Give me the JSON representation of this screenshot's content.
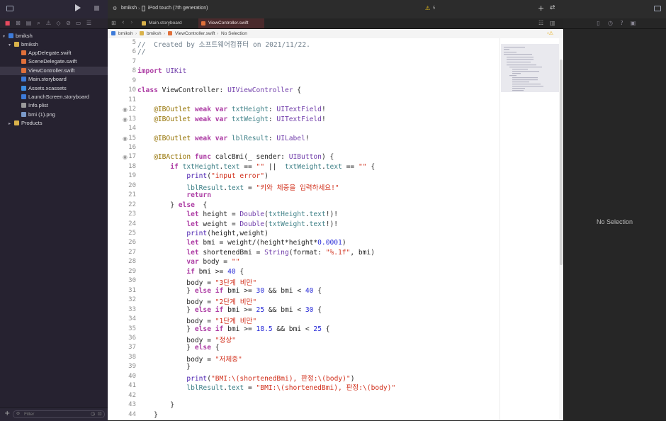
{
  "toolbar": {
    "scheme": "bmiksh",
    "device": "iPod touch (7th generation)",
    "warnings": "5"
  },
  "tabs": [
    {
      "label": "Main.storyboard"
    },
    {
      "label": "ViewController.swift"
    }
  ],
  "jumpbar": {
    "project": "bmiksh",
    "folder": "bmiksh",
    "file": "ViewController.swift",
    "selection": "No Selection"
  },
  "navigator": {
    "project": "bmiksh",
    "group": "bmiksh",
    "files": [
      {
        "name": "AppDelegate.swift",
        "color": "#e0703a"
      },
      {
        "name": "SceneDelegate.swift",
        "color": "#e0703a"
      },
      {
        "name": "ViewController.swift",
        "color": "#e0703a"
      },
      {
        "name": "Main.storyboard",
        "color": "#3d7bd9"
      },
      {
        "name": "Assets.xcassets",
        "color": "#3d8de0"
      },
      {
        "name": "LaunchScreen.storyboard",
        "color": "#3d7bd9"
      },
      {
        "name": "Info.plist",
        "color": "#9b9b9b"
      },
      {
        "name": "bmi (1).png",
        "color": "#7b9ac9"
      }
    ],
    "products": "Products",
    "filter_placeholder": "Filter"
  },
  "code_lines": [
    {
      "n": "5",
      "src": "//  Created by 소프트웨어컴퓨터 on 2021/11/22."
    },
    {
      "n": "6",
      "src": "//"
    },
    {
      "n": "7",
      "src": ""
    },
    {
      "n": "8",
      "src": "import UIKit"
    },
    {
      "n": "9",
      "src": ""
    },
    {
      "n": "10",
      "src": "class ViewController: UIViewController {"
    },
    {
      "n": "11",
      "src": ""
    },
    {
      "n": "12",
      "src": "    @IBOutlet weak var txtHeight: UITextField!"
    },
    {
      "n": "13",
      "src": "    @IBOutlet weak var txtWeight: UITextField!"
    },
    {
      "n": "14",
      "src": ""
    },
    {
      "n": "15",
      "src": "    @IBOutlet weak var lblResult: UILabel!"
    },
    {
      "n": "16",
      "src": ""
    },
    {
      "n": "17",
      "src": "    @IBAction func calcBmi(_ sender: UIButton) {"
    },
    {
      "n": "18",
      "src": "        if txtHeight.text == \"\" ||  txtWeight.text == \"\" {"
    },
    {
      "n": "19",
      "src": "            print(\"input error\")"
    },
    {
      "n": "20",
      "src": "            lblResult.text = \"키와 체중을 입력하세요!\""
    },
    {
      "n": "21",
      "src": "            return"
    },
    {
      "n": "22",
      "src": "        } else  {"
    },
    {
      "n": "23",
      "src": "            let height = Double(txtHeight.text!)!"
    },
    {
      "n": "24",
      "src": "            let weight = Double(txtWeight.text!)!"
    },
    {
      "n": "25",
      "src": "            print(height,weight)"
    },
    {
      "n": "26",
      "src": "            let bmi = weight/(height*height*0.0001)"
    },
    {
      "n": "27",
      "src": "            let shortenedBmi = String(format: \"%.1f\", bmi)"
    },
    {
      "n": "28",
      "src": "            var body = \"\""
    },
    {
      "n": "29",
      "src": "            if bmi >= 40 {"
    },
    {
      "n": "30",
      "src": "            body = \"3단계 비만\""
    },
    {
      "n": "31",
      "src": "            } else if bmi >= 30 && bmi < 40 {"
    },
    {
      "n": "32",
      "src": "            body = \"2단계 비만\""
    },
    {
      "n": "33",
      "src": "            } else if bmi >= 25 && bmi < 30 {"
    },
    {
      "n": "34",
      "src": "            body = \"1단계 비만\""
    },
    {
      "n": "35",
      "src": "            } else if bmi >= 18.5 && bmi < 25 {"
    },
    {
      "n": "36",
      "src": "            body = \"정상\""
    },
    {
      "n": "37",
      "src": "            } else {"
    },
    {
      "n": "38",
      "src": "            body = \"저체중\""
    },
    {
      "n": "39",
      "src": "            }"
    },
    {
      "n": "40",
      "src": "            print(\"BMI:\\(shortenedBmi), 판정:\\(body)\")"
    },
    {
      "n": "41",
      "src": "            lblResult.text = \"BMI:\\(shortenedBmi), 판정:\\(body)\""
    },
    {
      "n": "42",
      "src": ""
    },
    {
      "n": "43",
      "src": "        }"
    },
    {
      "n": "44",
      "src": "    }"
    }
  ],
  "breakpoint_lines": [
    "12",
    "13",
    "15",
    "17"
  ],
  "inspector": {
    "empty_label": "No Selection"
  },
  "colors": {
    "active_tab": "#4a2a2c",
    "keyword": "#ad3da4",
    "string": "#d12f1b",
    "number": "#272ad8",
    "type": "#703daa"
  }
}
